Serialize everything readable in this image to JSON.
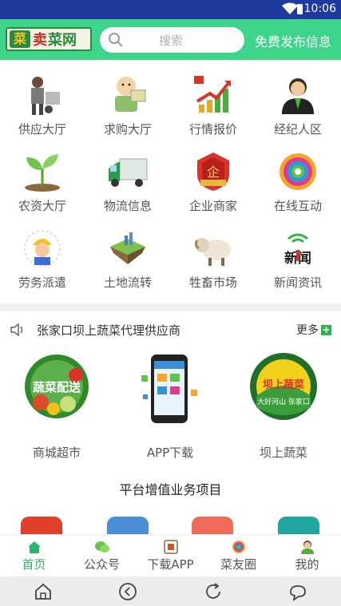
{
  "status_bar": {
    "time": "10:06"
  },
  "header": {
    "logo": {
      "char1": "菜",
      "text_red": "卖",
      "text_green": "菜网"
    },
    "search_placeholder": "搜索",
    "publish_label": "免费发布信息"
  },
  "categories": [
    {
      "label": "供应大厅",
      "icon": "supplier-icon"
    },
    {
      "label": "求购大厅",
      "icon": "buyer-icon"
    },
    {
      "label": "行情报价",
      "icon": "market-trend-icon"
    },
    {
      "label": "经纪人区",
      "icon": "agent-icon"
    },
    {
      "label": "农资大厅",
      "icon": "sprout-icon"
    },
    {
      "label": "物流信息",
      "icon": "truck-icon"
    },
    {
      "label": "企业商家",
      "icon": "enterprise-badge-icon"
    },
    {
      "label": "在线互动",
      "icon": "chat-circle-icon"
    },
    {
      "label": "劳务派遣",
      "icon": "worker-icon"
    },
    {
      "label": "土地流转",
      "icon": "land-icon"
    },
    {
      "label": "牲畜市场",
      "icon": "sheep-icon"
    },
    {
      "label": "新闻资讯",
      "icon": "news-icon"
    }
  ],
  "notice": {
    "text": "张家口坝上蔬菜代理供应商",
    "more": "更多"
  },
  "features": [
    {
      "label": "商城超市",
      "badge_text": "蔬菜配送"
    },
    {
      "label": "APP下载"
    },
    {
      "label": "坝上蔬菜",
      "badge_text": "坝上蔬菜",
      "badge_sub": "大好河山 张家口"
    }
  ],
  "value_added_title": "平台增值业务项目",
  "tabs": [
    {
      "label": "首页",
      "icon": "home-icon"
    },
    {
      "label": "公众号",
      "icon": "wechat-icon"
    },
    {
      "label": "下载APP",
      "icon": "download-app-icon"
    },
    {
      "label": "菜友圈",
      "icon": "friends-circle-icon"
    },
    {
      "label": "我的",
      "icon": "profile-icon"
    }
  ],
  "colors": {
    "brand_green": "#3dd58a",
    "status_bar": "#1f3a9e",
    "tab_active": "#2fb36a"
  }
}
